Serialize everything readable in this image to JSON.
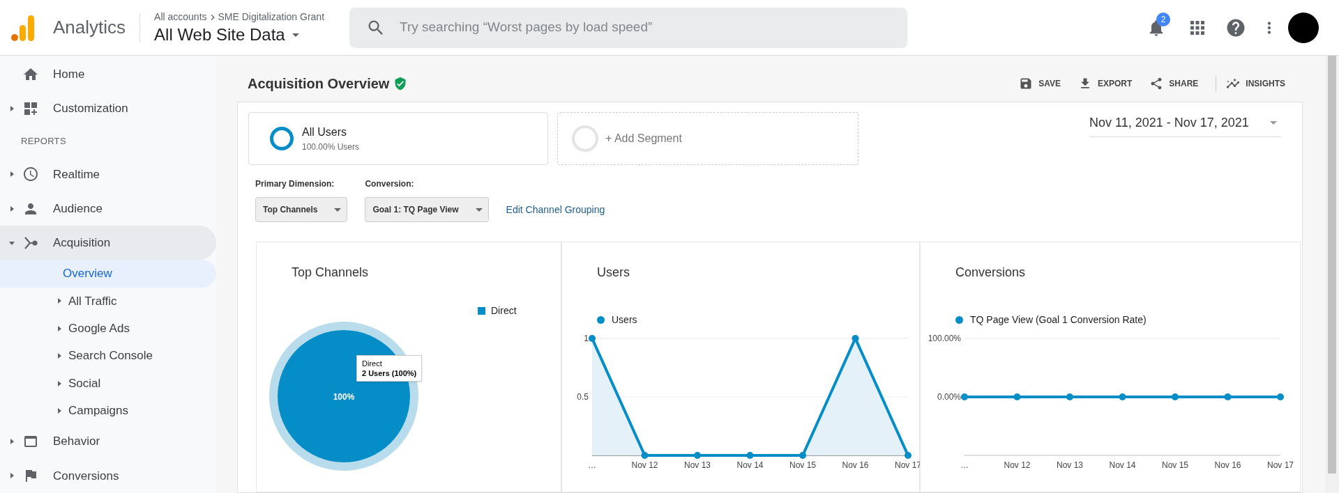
{
  "header": {
    "product": "Analytics",
    "breadcrumb": [
      "All accounts",
      "SME Digitalization Grant"
    ],
    "view": "All Web Site Data",
    "search": {
      "placeholder": "Try searching “Worst pages by load speed”"
    },
    "notifications": "2"
  },
  "sidebar": {
    "items": [
      {
        "kind": "link",
        "label": "Home",
        "selected": false
      },
      {
        "kind": "link",
        "label": "Customization",
        "expanded": false,
        "selected": false
      },
      {
        "kind": "heading",
        "label": "REPORTS"
      },
      {
        "kind": "link",
        "label": "Realtime",
        "expanded": false,
        "selected": false
      },
      {
        "kind": "link",
        "label": "Audience",
        "expanded": false,
        "selected": false
      },
      {
        "kind": "link",
        "label": "Acquisition",
        "expanded": true,
        "selected": true,
        "children": [
          {
            "label": "Overview",
            "selected": true
          },
          {
            "label": "All Traffic",
            "expanded": false,
            "selected": false
          },
          {
            "label": "Google Ads",
            "expanded": false,
            "selected": false
          },
          {
            "label": "Search Console",
            "expanded": false,
            "selected": false
          },
          {
            "label": "Social",
            "expanded": false,
            "selected": false
          },
          {
            "label": "Campaigns",
            "expanded": false,
            "selected": false
          }
        ]
      },
      {
        "kind": "link",
        "label": "Behavior",
        "expanded": false,
        "selected": false
      },
      {
        "kind": "link",
        "label": "Conversions",
        "expanded": false,
        "selected": false
      }
    ]
  },
  "page": {
    "title": "Acquisition Overview",
    "verified": true,
    "actions": [
      "SAVE",
      "EXPORT",
      "SHARE",
      "INSIGHTS"
    ]
  },
  "segments": [
    {
      "name": "All Users",
      "detail": "100.00% Users"
    }
  ],
  "add_segment": "+ Add Segment",
  "date_range": "Nov 11, 2021 - Nov 17, 2021",
  "controls": [
    {
      "label": "Primary Dimension:",
      "value": "Top Channels"
    },
    {
      "label": "Conversion:",
      "value": "Goal 1: TQ Page View"
    }
  ],
  "link": "Edit Channel Grouping",
  "panels": [
    {
      "title": "Top Channels",
      "tooltip": {
        "title": "Direct",
        "text": "2 Users (100%)"
      },
      "chart_data": {
        "type": "pie",
        "categories": [
          "Direct"
        ],
        "series": [
          {
            "color": "#058dc7",
            "values": [
              100
            ]
          }
        ],
        "value_labels": [
          "100%"
        ]
      }
    },
    {
      "title": "Users",
      "chart_data": {
        "type": "area",
        "x": [
          "…",
          "Nov 12",
          "Nov 13",
          "Nov 14",
          "Nov 15",
          "Nov 16",
          "Nov 17"
        ],
        "series": [
          {
            "name": "Users",
            "color": "#058dc7",
            "marker": "circle",
            "values": [
              1,
              0,
              0,
              0,
              0,
              1,
              0
            ]
          }
        ],
        "ylim": [
          0,
          1
        ],
        "yticks": [
          0.5,
          1
        ]
      }
    },
    {
      "title": "Conversions",
      "chart_data": {
        "type": "line",
        "x": [
          "…",
          "Nov 12",
          "Nov 13",
          "Nov 14",
          "Nov 15",
          "Nov 16",
          "Nov 17"
        ],
        "series": [
          {
            "name": "TQ Page View (Goal 1 Conversion Rate)",
            "color": "#058dc7",
            "marker": "circle",
            "values": [
              0,
              0,
              0,
              0,
              0,
              0,
              0
            ]
          }
        ],
        "ylim": [
          -1,
          1
        ],
        "yticks": [
          {
            "value": 0,
            "label": "0.00%"
          },
          {
            "value": 1,
            "label": "100.00%"
          }
        ]
      }
    }
  ]
}
